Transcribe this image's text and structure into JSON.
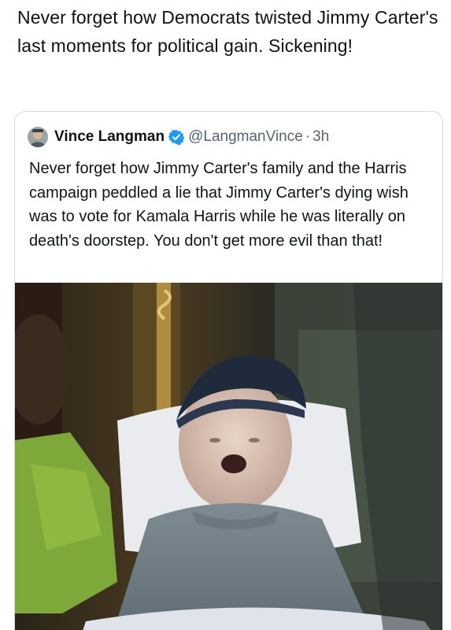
{
  "post": {
    "caption": "Never forget how Democrats twisted Jimmy Carter's last moments for political gain. Sickening!"
  },
  "quoted_tweet": {
    "author_name": "Vince Langman",
    "author_handle": "@LangmanVince",
    "separator": "·",
    "timestamp": "3h",
    "verified": true,
    "text": "Never forget how Jimmy Carter's family and the Harris campaign peddled a lie that Jimmy Carter's dying wish was to vote for Kamala Harris while he was literally on death's doorstep. You don't get more evil than that!"
  },
  "colors": {
    "text_primary": "#0f1419",
    "text_secondary": "#536471",
    "verified_badge": "#1d9bf0",
    "card_border": "#d6dbe0"
  },
  "icons": {
    "avatar": "profile-avatar",
    "verified": "verified-badge-icon"
  }
}
